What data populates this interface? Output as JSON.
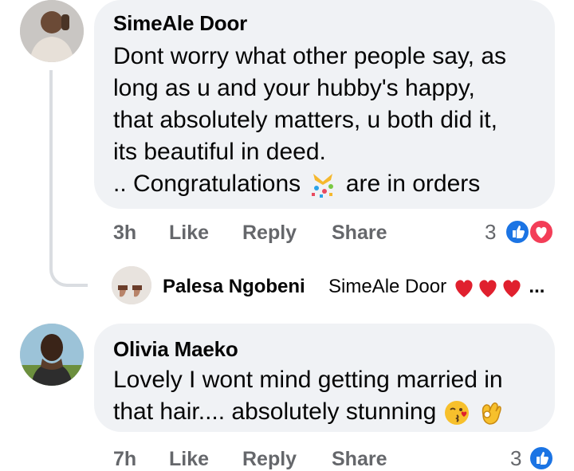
{
  "comment1": {
    "author": "SimeAle Door",
    "lines": [
      "Dont worry what other people say, as",
      "long as u and your hubby's happy,",
      "that absolutely matters, u both did it,",
      "its beautiful in deed.",
      ".. Congratulations",
      "are in orders"
    ],
    "time": "3h",
    "like": "Like",
    "reply": "Reply",
    "share": "Share",
    "reaction_count": "3"
  },
  "reply1": {
    "author": "Palesa Ngobeni",
    "text": "SimeAle Door",
    "ellipsis": "..."
  },
  "comment2": {
    "author": "Olivia Maeko",
    "lines": [
      "Lovely I wont mind getting married in",
      "that hair.... absolutely stunning"
    ],
    "time": "7h",
    "like": "Like",
    "reply": "Reply",
    "share": "Share",
    "reaction_count": "3"
  },
  "colors": {
    "like_blue": "#1b74e4",
    "love_red": "#f33e58",
    "bubble_bg": "#f0f2f5",
    "meta_gray": "#65676b"
  },
  "icons": [
    "like-reaction-icon",
    "love-reaction-icon",
    "heart-emoji-icon",
    "party-popper-emoji-icon",
    "kiss-emoji-icon",
    "ok-hand-emoji-icon"
  ]
}
